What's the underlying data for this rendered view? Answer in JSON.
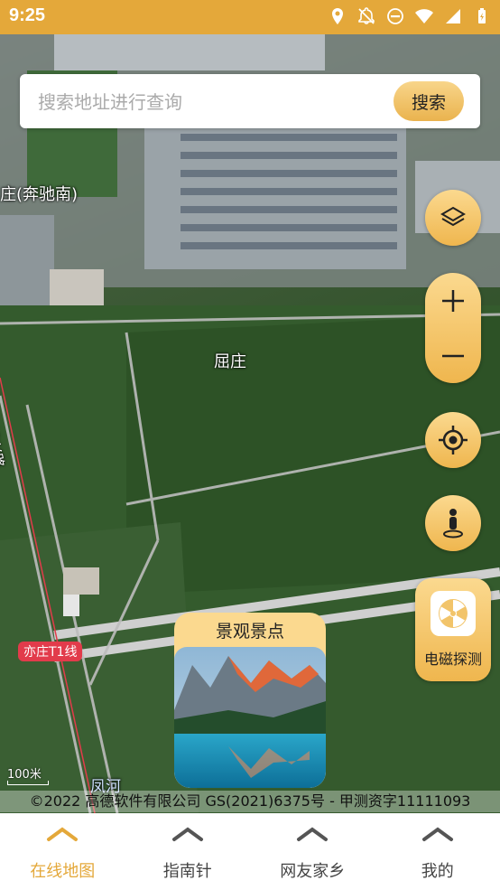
{
  "status_bar": {
    "time": "9:25"
  },
  "search": {
    "placeholder": "搜索地址进行查询",
    "value": "",
    "button_label": "搜索"
  },
  "map": {
    "labels": {
      "place_1": "庄(奔驰南)",
      "place_2": "屈庄",
      "road_vertical": "博兴路",
      "river": "凤河"
    },
    "line_badge": "亦庄T1线",
    "scale": "100米",
    "copyright": "©2022 高德软件有限公司 GS(2021)6375号 - 甲测资字11111093"
  },
  "controls": {
    "layers_icon": "layers-icon",
    "zoom_in_icon": "plus-icon",
    "zoom_out_icon": "minus-icon",
    "locate_icon": "locate-icon",
    "street_view_icon": "person-icon",
    "emf_icon": "radiation-icon",
    "emf_label": "电磁探测"
  },
  "scenic_card": {
    "title": "景观景点"
  },
  "bottom_nav": {
    "items": [
      {
        "label": "在线地图",
        "active": true
      },
      {
        "label": "指南针",
        "active": false
      },
      {
        "label": "网友家乡",
        "active": false
      },
      {
        "label": "我的",
        "active": false
      }
    ]
  },
  "colors": {
    "accent": "#e4a83a",
    "button": "#f2bc5a",
    "line_badge": "#e23b4b"
  }
}
